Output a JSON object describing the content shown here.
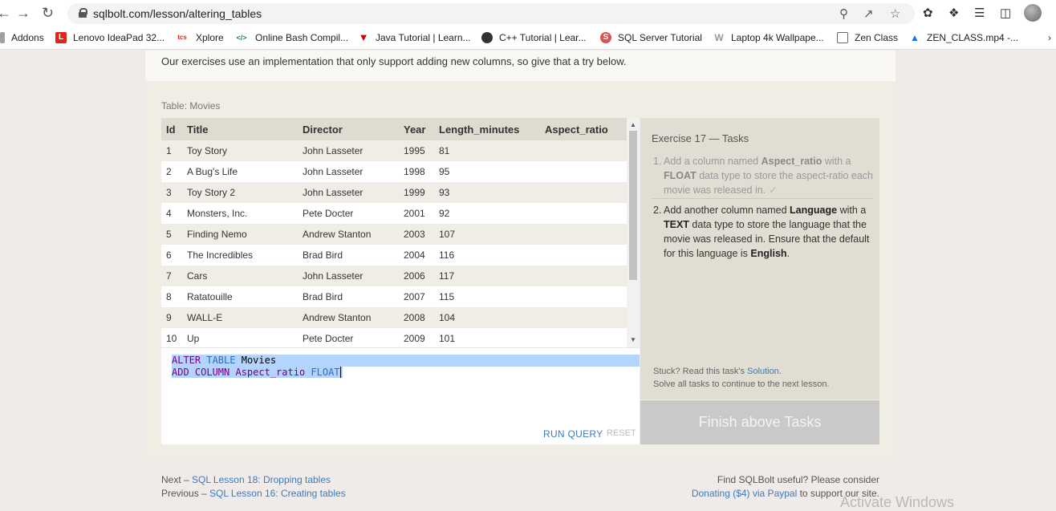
{
  "browser": {
    "url": "sqlbolt.com/lesson/altering_tables",
    "bookmarks": [
      {
        "label": "Addons",
        "color": "#5f6368",
        "glyph": "•"
      },
      {
        "label": "Lenovo IdeaPad 32...",
        "color": "#e2231a",
        "glyph": "L"
      },
      {
        "label": "Xplore",
        "color": "#e2231a",
        "glyph": "tcs"
      },
      {
        "label": "Online Bash Compil...",
        "color": "#1b8a3c",
        "glyph": "</>"
      },
      {
        "label": "Java Tutorial | Learn...",
        "color": "#c00",
        "glyph": "▼"
      },
      {
        "label": "C++ Tutorial | Lear...",
        "color": "#333",
        "glyph": "●"
      },
      {
        "label": "SQL Server Tutorial",
        "color": "#d9534f",
        "glyph": "S"
      },
      {
        "label": "Laptop 4k Wallpape...",
        "color": "#888",
        "glyph": "W"
      },
      {
        "label": "Zen Class",
        "color": "#666",
        "glyph": "▣"
      },
      {
        "label": "ZEN_CLASS.mp4 -...",
        "color": "#1a73e8",
        "glyph": "▲"
      }
    ]
  },
  "page": {
    "intro": "Our exercises use an implementation that only support adding new columns, so give that a try below.",
    "table_caption": "Table: Movies",
    "columns": [
      "Id",
      "Title",
      "Director",
      "Year",
      "Length_minutes",
      "Aspect_ratio"
    ],
    "rows": [
      [
        "1",
        "Toy Story",
        "John Lasseter",
        "1995",
        "81",
        ""
      ],
      [
        "2",
        "A Bug's Life",
        "John Lasseter",
        "1998",
        "95",
        ""
      ],
      [
        "3",
        "Toy Story 2",
        "John Lasseter",
        "1999",
        "93",
        ""
      ],
      [
        "4",
        "Monsters, Inc.",
        "Pete Docter",
        "2001",
        "92",
        ""
      ],
      [
        "5",
        "Finding Nemo",
        "Andrew Stanton",
        "2003",
        "107",
        ""
      ],
      [
        "6",
        "The Incredibles",
        "Brad Bird",
        "2004",
        "116",
        ""
      ],
      [
        "7",
        "Cars",
        "John Lasseter",
        "2006",
        "117",
        ""
      ],
      [
        "8",
        "Ratatouille",
        "Brad Bird",
        "2007",
        "115",
        ""
      ],
      [
        "9",
        "WALL-E",
        "Andrew Stanton",
        "2008",
        "104",
        ""
      ],
      [
        "10",
        "Up",
        "Pete Docter",
        "2009",
        "101",
        ""
      ]
    ],
    "editor": {
      "line1": {
        "kw1": "ALTER",
        "kw2": "TABLE",
        "rest": "Movies"
      },
      "line2": {
        "kw1": "ADD COLUMN Aspect_ratio",
        "kw2": "FLOAT"
      },
      "run_label": "RUN QUERY",
      "reset_label": "RESET"
    },
    "tasks": {
      "title": "Exercise 17 — Tasks",
      "task1": {
        "num": "1.",
        "a": "Add a column named ",
        "b": "Aspect_ratio",
        "c": " with a ",
        "d": "FLOAT",
        "e": " data type to store the aspect-ratio each movie was released in.",
        "check": "✓"
      },
      "task2": {
        "num": "2.",
        "a": "Add another column named ",
        "b": "Language",
        "c": " with a ",
        "d": "TEXT",
        "e": " data type to store the language that the movie was released in. Ensure that the default for this language is ",
        "f": "English",
        "g": "."
      },
      "stuck_prefix": "Stuck? Read this task's ",
      "stuck_link": "Solution",
      "stuck_suffix": ".",
      "stuck_line2": "Solve all tasks to continue to the next lesson.",
      "finish_label": "Finish above Tasks"
    },
    "footer": {
      "next_prefix": "Next – ",
      "next_link": "SQL Lesson 18: Dropping tables",
      "prev_prefix": "Previous – ",
      "prev_link": "SQL Lesson 16: Creating tables",
      "right_line1": "Find SQLBolt useful? Please consider",
      "right_link": "Donating ($4) via Paypal",
      "right_suffix": " to support our site."
    },
    "watermark": "Activate Windows"
  }
}
